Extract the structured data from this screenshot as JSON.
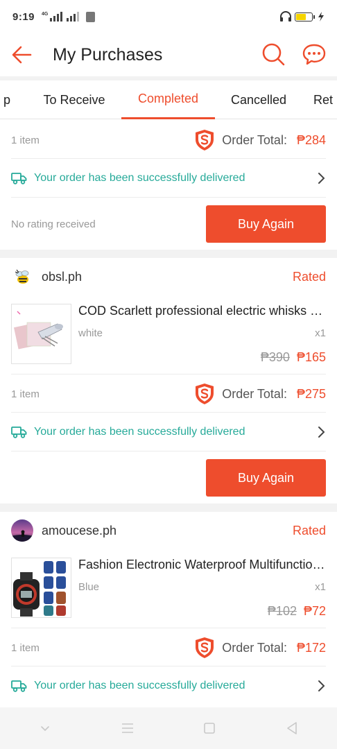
{
  "status_bar": {
    "time": "9:19",
    "network_type": "4G"
  },
  "header": {
    "title": "My Purchases"
  },
  "tabs": [
    {
      "label": "p"
    },
    {
      "label": "To Receive"
    },
    {
      "label": "Completed"
    },
    {
      "label": "Cancelled"
    },
    {
      "label": "Ret"
    }
  ],
  "active_tab": "Completed",
  "colors": {
    "accent": "#ee4d2d",
    "delivered_green": "#26aa99"
  },
  "orders": [
    {
      "item_count": "1 item",
      "order_total_label": "Order Total:",
      "order_total": "₱284",
      "delivery_status": "Your order has been successfully delivered",
      "rating_status": "No rating received",
      "buy_again_label": "Buy Again"
    },
    {
      "shop_name": "obsl.ph",
      "rating_status": "Rated",
      "product_name": "COD Scarlett professional electric whisks hand mixer",
      "variation": "white",
      "quantity": "x1",
      "original_price": "₱390",
      "price": "₱165",
      "item_count": "1 item",
      "order_total_label": "Order Total:",
      "order_total": "₱275",
      "delivery_status": "Your order has been successfully delivered",
      "buy_again_label": "Buy Again"
    },
    {
      "shop_name": "amoucese.ph",
      "rating_status": "Rated",
      "product_name": "Fashion Electronic Waterproof Multifunctional Sport Watch",
      "variation": "Blue",
      "quantity": "x1",
      "original_price": "₱102",
      "price": "₱72",
      "item_count": "1 item",
      "order_total_label": "Order Total:",
      "order_total": "₱172",
      "delivery_status": "Your order has been successfully delivered"
    }
  ]
}
